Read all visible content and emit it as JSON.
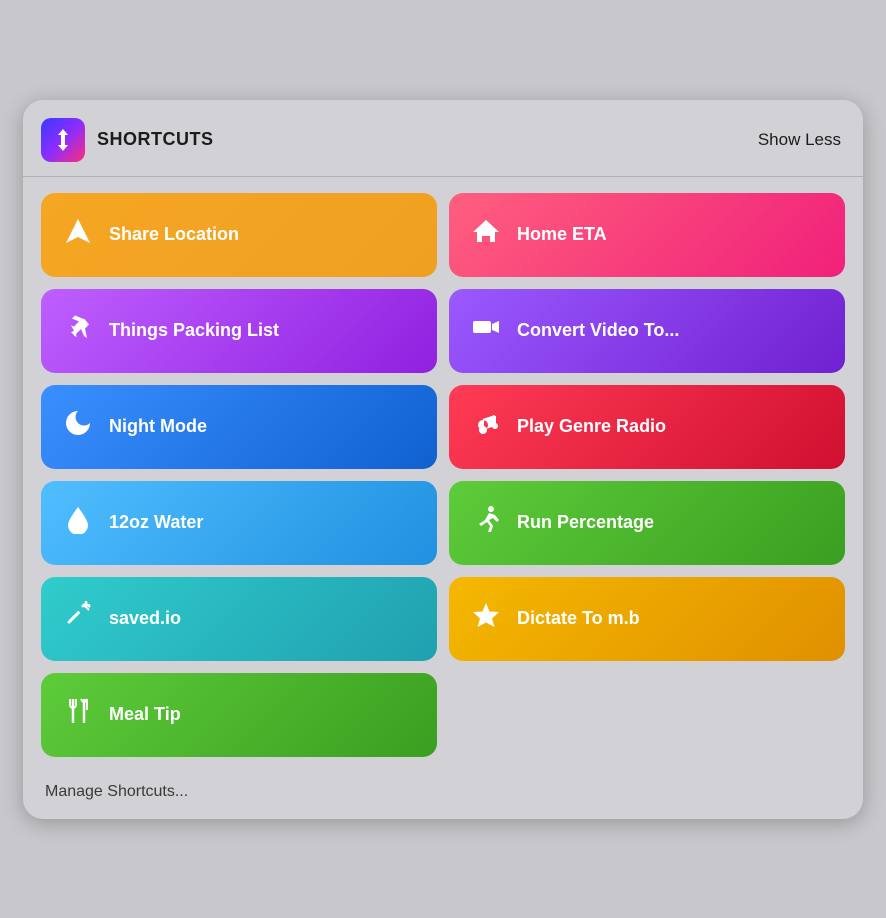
{
  "header": {
    "app_name": "SHORTCUTS",
    "show_less_label": "Show Less"
  },
  "shortcuts": [
    {
      "id": "share-location",
      "label": "Share Location",
      "icon": "navigation",
      "color_class": "btn-share-location",
      "col": 1
    },
    {
      "id": "home-eta",
      "label": "Home ETA",
      "icon": "home",
      "color_class": "btn-home-eta",
      "col": 2
    },
    {
      "id": "things-packing",
      "label": "Things Packing List",
      "icon": "plane",
      "color_class": "btn-things-packing",
      "col": 1
    },
    {
      "id": "convert-video",
      "label": "Convert Video To...",
      "icon": "video",
      "color_class": "btn-convert-video",
      "col": 2
    },
    {
      "id": "night-mode",
      "label": "Night Mode",
      "icon": "moon",
      "color_class": "btn-night-mode",
      "col": 1
    },
    {
      "id": "play-genre",
      "label": "Play Genre Radio",
      "icon": "music",
      "color_class": "btn-play-genre",
      "col": 2
    },
    {
      "id": "water",
      "label": "12oz Water",
      "icon": "drop",
      "color_class": "btn-water",
      "col": 1
    },
    {
      "id": "run-percentage",
      "label": "Run Percentage",
      "icon": "run",
      "color_class": "btn-run-percentage",
      "col": 2
    },
    {
      "id": "saved-io",
      "label": "saved.io",
      "icon": "wand",
      "color_class": "btn-saved-io",
      "col": 1
    },
    {
      "id": "dictate",
      "label": "Dictate To m.b",
      "icon": "star",
      "color_class": "btn-dictate",
      "col": 2
    },
    {
      "id": "meal-tip",
      "label": "Meal Tip",
      "icon": "utensils",
      "color_class": "btn-meal-tip",
      "col": 1
    }
  ],
  "manage_label": "Manage Shortcuts..."
}
